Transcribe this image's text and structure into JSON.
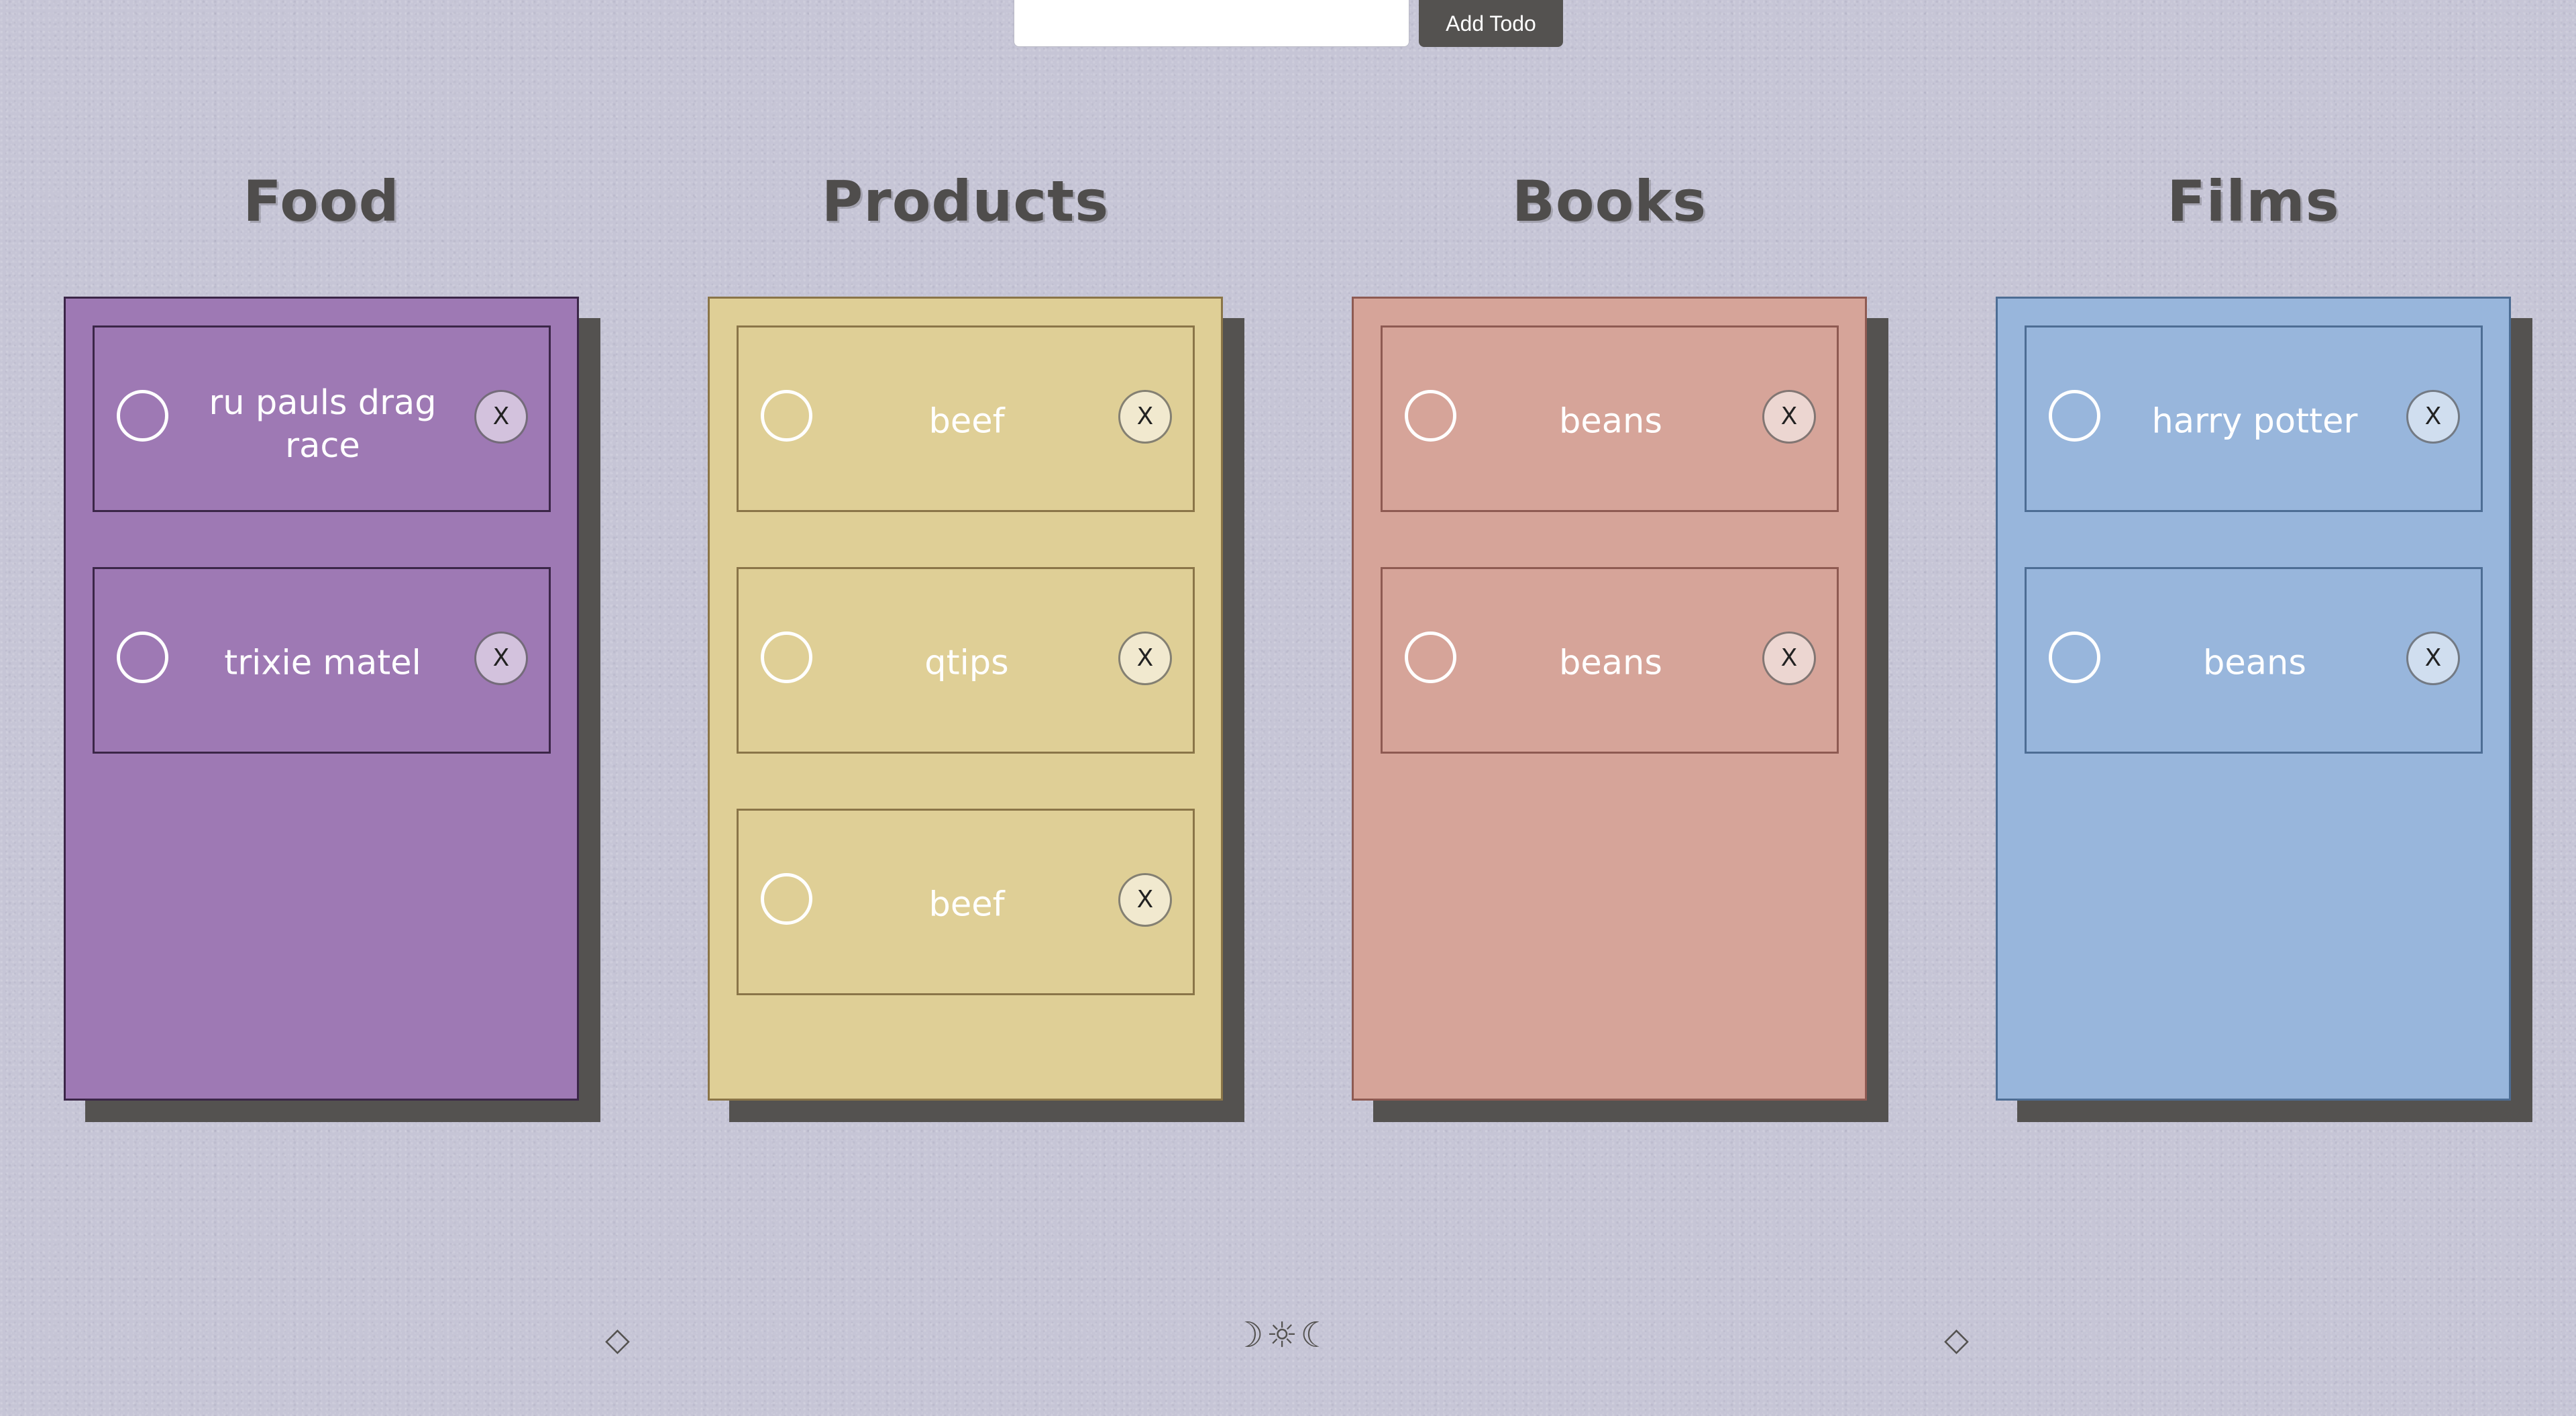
{
  "todo_form": {
    "input_value": "",
    "input_placeholder": "",
    "add_button_label": "Add Todo"
  },
  "columns": [
    {
      "title": "Food",
      "color": "#9e79b4",
      "border_color": "#3b2648",
      "items": [
        {
          "text": "ru pauls drag race",
          "delete_label": "X"
        },
        {
          "text": "trixie matel",
          "delete_label": "X"
        }
      ]
    },
    {
      "title": "Products",
      "color": "#dfcf96",
      "border_color": "#8a7548",
      "items": [
        {
          "text": "beef",
          "delete_label": "X"
        },
        {
          "text": "qtips",
          "delete_label": "X"
        },
        {
          "text": "beef",
          "delete_label": "X"
        }
      ]
    },
    {
      "title": "Books",
      "color": "#d6a499",
      "border_color": "#8e5a52",
      "items": [
        {
          "text": "beans",
          "delete_label": "X"
        },
        {
          "text": "beans",
          "delete_label": "X"
        }
      ]
    },
    {
      "title": "Films",
      "color": "#98b6dc",
      "border_color": "#4d6d94",
      "items": [
        {
          "text": "harry potter",
          "delete_label": "X"
        },
        {
          "text": "beans",
          "delete_label": "X"
        }
      ]
    }
  ],
  "footer": {
    "left_symbol": "◇",
    "center_symbols": "☽☼☾",
    "right_symbol": "◇"
  },
  "icons": {
    "check": "circle-outline-icon",
    "delete": "x-icon",
    "footer_left": "diamond-icon",
    "footer_center": "moon-sun-moon-icon",
    "footer_right": "diamond-icon"
  }
}
